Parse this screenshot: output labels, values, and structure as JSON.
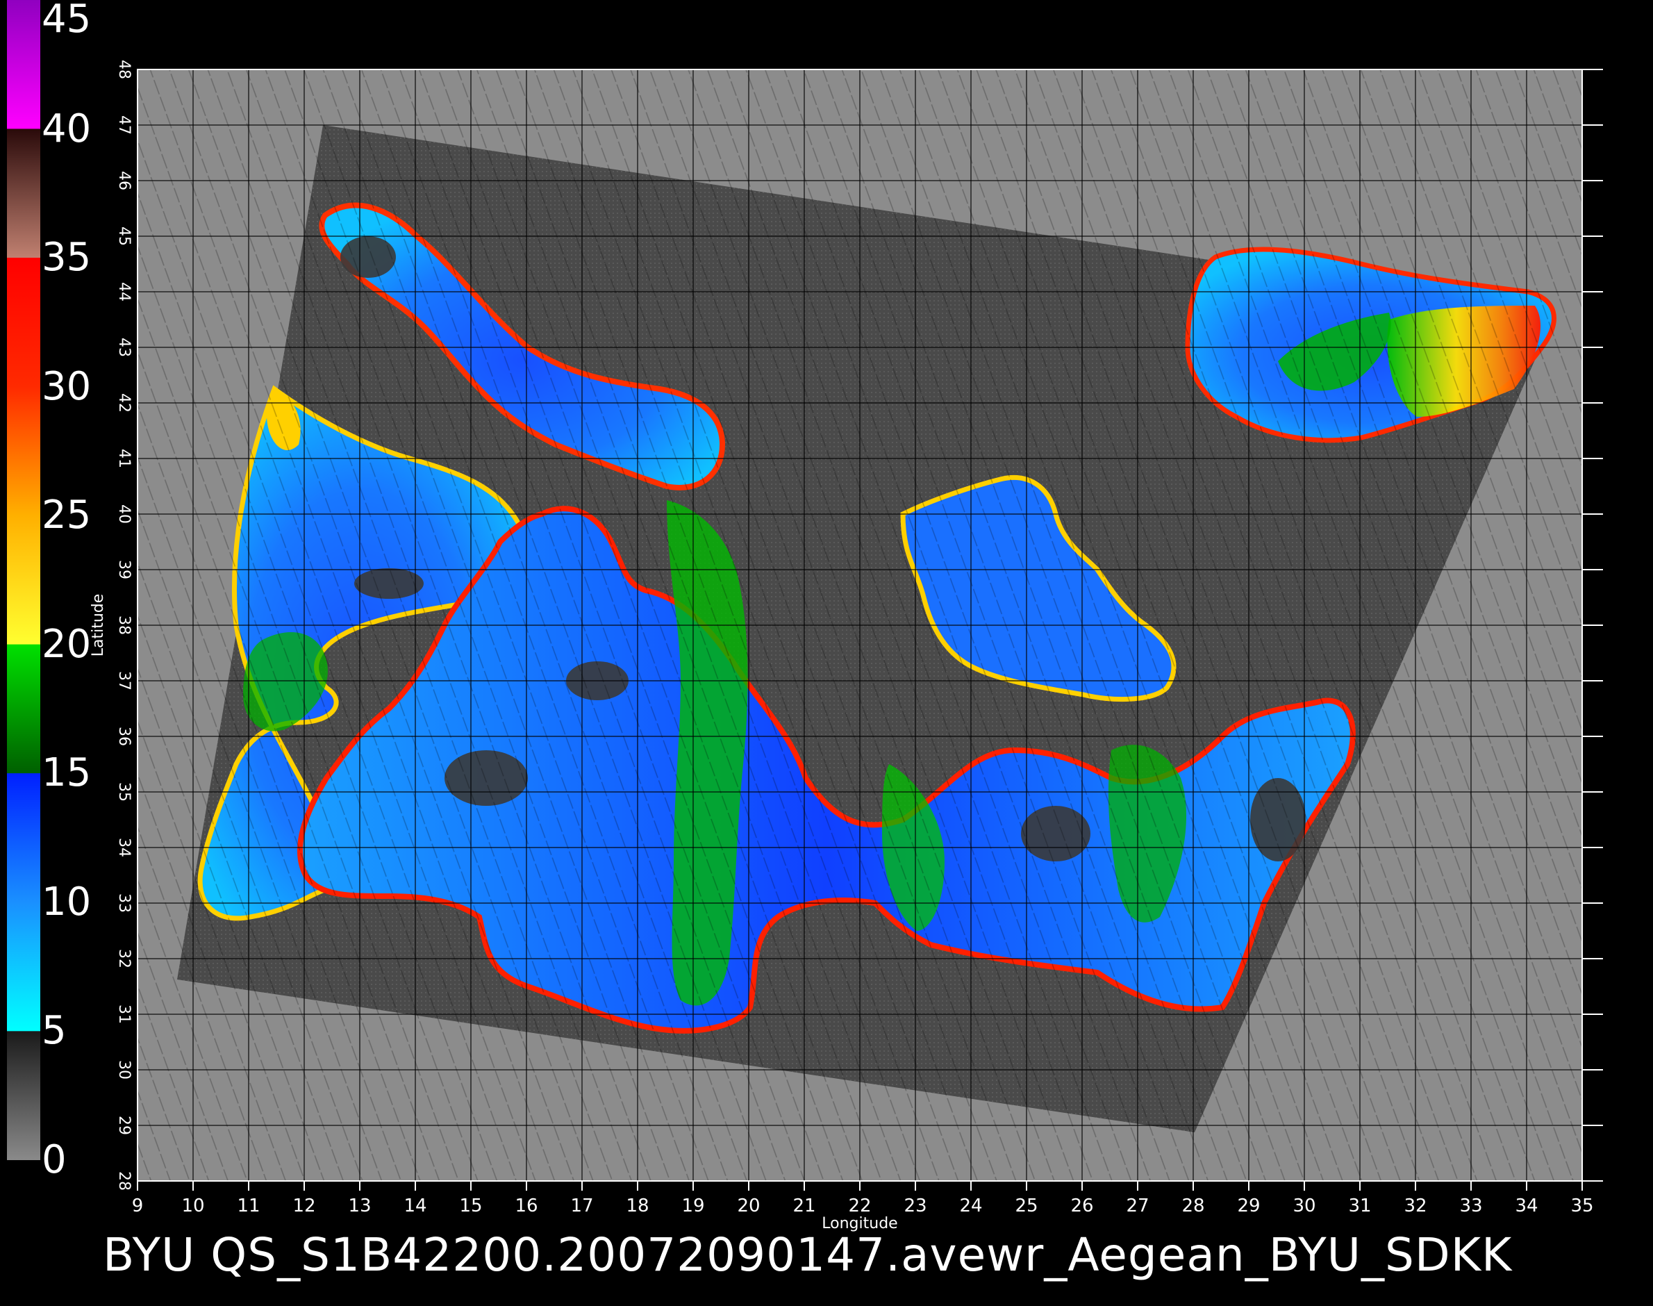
{
  "title": "BYU  QS_S1B42200.20072090147.avewr_Aegean_BYU_SDKK",
  "colorbar": {
    "labels": [
      "45",
      "40",
      "35",
      "30",
      "25",
      "20",
      "15",
      "10",
      "5",
      "0"
    ],
    "min": 0,
    "max": 45,
    "stops": [
      {
        "value": 0,
        "color": "#8a8a8a"
      },
      {
        "value": 5,
        "color": "#1a1a1a"
      },
      {
        "value": 5.01,
        "color": "#00ffff"
      },
      {
        "value": 10,
        "color": "#1a90ff"
      },
      {
        "value": 15,
        "color": "#0020ff"
      },
      {
        "value": 15.01,
        "color": "#006000"
      },
      {
        "value": 20,
        "color": "#00e000"
      },
      {
        "value": 20.01,
        "color": "#ffff30"
      },
      {
        "value": 25,
        "color": "#ffb000"
      },
      {
        "value": 30,
        "color": "#ff2a00"
      },
      {
        "value": 35,
        "color": "#ff0000"
      },
      {
        "value": 35.01,
        "color": "#c08070"
      },
      {
        "value": 40,
        "color": "#2a0a0a"
      },
      {
        "value": 40.01,
        "color": "#ff00ff"
      },
      {
        "value": 45,
        "color": "#9000c0"
      }
    ]
  },
  "axes": {
    "xlabel": "Longitude",
    "ylabel": "Latitude",
    "lon_ticks": [
      "9",
      "10",
      "11",
      "12",
      "13",
      "14",
      "15",
      "16",
      "17",
      "18",
      "19",
      "20",
      "21",
      "22",
      "23",
      "24",
      "25",
      "26",
      "27",
      "28",
      "29",
      "30",
      "31",
      "32",
      "33",
      "34",
      "35"
    ],
    "lat_ticks": [
      "28",
      "29",
      "30",
      "31",
      "32",
      "33",
      "34",
      "35",
      "36",
      "37",
      "38",
      "39",
      "40",
      "41",
      "42",
      "43",
      "44",
      "45",
      "46",
      "47",
      "48"
    ],
    "lon_range": [
      9,
      35
    ],
    "lat_range": [
      28,
      48
    ],
    "grid": true
  },
  "colors": {
    "background": "#000000",
    "plot_background": "#8c8c8c",
    "swath": "#4a4a4a",
    "sea_low": "#1f5cff",
    "sea_mid": "#1ab8ff",
    "sea_green": "#00b000",
    "coast_red": "#ff2000",
    "coast_yellow": "#ffe000"
  }
}
